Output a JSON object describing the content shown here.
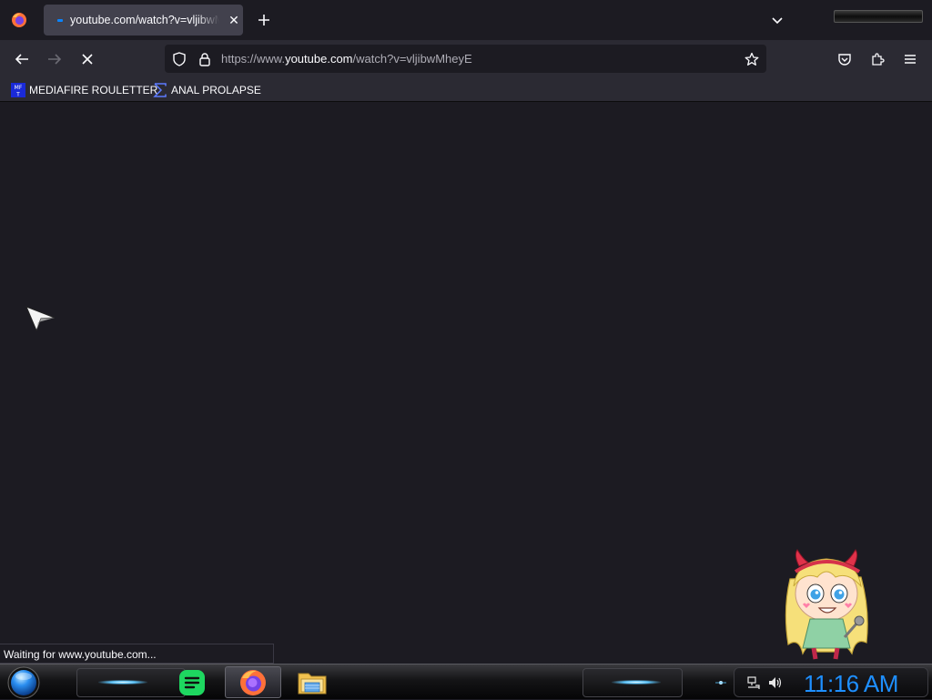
{
  "tabstrip": {
    "tab": {
      "title": "youtube.com/watch?v=vljibwMheyE",
      "close_glyph": "✕"
    },
    "new_tab_glyph": "+",
    "tab_list_icon": "chevron-down-icon"
  },
  "navbar": {
    "url_scheme": "https://www.",
    "url_host": "youtube.com",
    "url_path": "/watch?v=vljibwMheyE",
    "back_icon": "arrow-left-icon",
    "forward_icon": "arrow-right-icon",
    "stop_icon": "stop-loading-icon"
  },
  "bookmarks": [
    {
      "label": "MEDIAFIRE ROULETTER",
      "icon": "mft-icon"
    },
    {
      "label": "ANAL PROLAPSE",
      "icon": "sigma-icon"
    }
  ],
  "status_text": "Waiting for www.youtube.com...",
  "taskbar": {
    "apps": [
      "spotify-icon",
      "firefox-icon",
      "file-explorer-icon"
    ],
    "clock": "11:16 AM"
  },
  "colors": {
    "accent": "#0a84ff",
    "clock": "#1e8fff",
    "content_bg": "#1c1b22",
    "toolbar_bg": "#2b2a33"
  }
}
